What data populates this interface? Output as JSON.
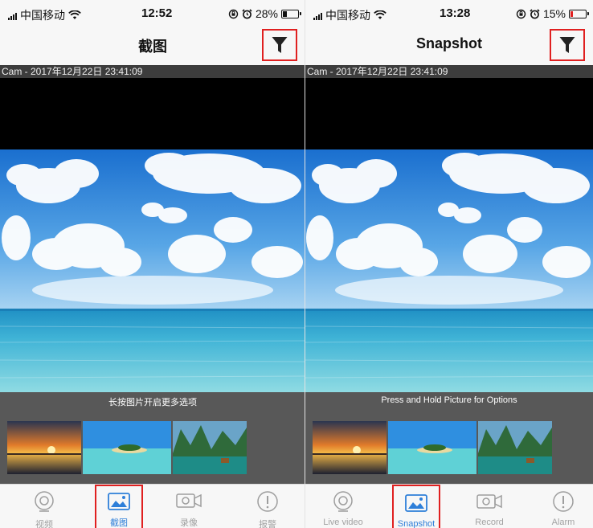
{
  "screens": [
    {
      "status": {
        "carrier": "中国移动",
        "time": "12:52",
        "battery": "28%",
        "battery_level": 0.28
      },
      "nav": {
        "title": "截图",
        "filter_icon": "filter-icon"
      },
      "meta_text": "Cam - 2017年12月22日 23:41:09",
      "hint": "长按图片开启更多选项",
      "tabs": [
        {
          "label": "视频",
          "icon": "live-video-icon",
          "active": false
        },
        {
          "label": "截图",
          "icon": "snapshot-icon",
          "active": true
        },
        {
          "label": "录像",
          "icon": "record-icon",
          "active": false
        },
        {
          "label": "报警",
          "icon": "alarm-icon",
          "active": false
        }
      ]
    },
    {
      "status": {
        "carrier": "中国移动",
        "time": "13:28",
        "battery": "15%",
        "battery_level": 0.15
      },
      "nav": {
        "title": "Snapshot",
        "filter_icon": "filter-icon"
      },
      "meta_text": "Cam - 2017年12月22日 23:41:09",
      "hint": "Press and Hold Picture for Options",
      "tabs": [
        {
          "label": "Live video",
          "icon": "live-video-icon",
          "active": false
        },
        {
          "label": "Snapshot",
          "icon": "snapshot-icon",
          "active": true
        },
        {
          "label": "Record",
          "icon": "record-icon",
          "active": false
        },
        {
          "label": "Alarm",
          "icon": "alarm-icon",
          "active": false
        }
      ]
    }
  ],
  "colors": {
    "accent_blue": "#2e7fd9",
    "highlight_red": "#e02020",
    "battery_low": "#e02020",
    "battery_normal": "#111111"
  }
}
